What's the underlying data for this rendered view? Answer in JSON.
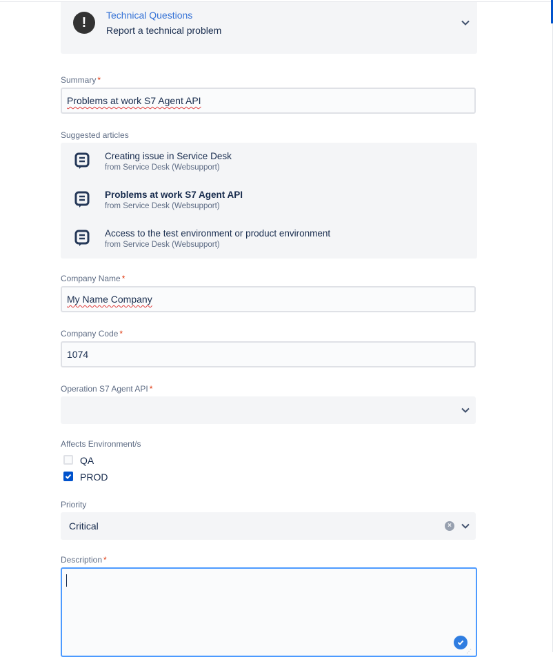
{
  "request_type": {
    "title": "Technical Questions",
    "description": "Report a technical problem",
    "icon": "exclamation-icon"
  },
  "summary": {
    "label": "Summary",
    "required_mark": "*",
    "value": "Problems at work S7 Agent API"
  },
  "suggested": {
    "label": "Suggested articles",
    "items": [
      {
        "title": "Creating issue in Service Desk",
        "source": "from Service Desk (Websupport)",
        "bold": false
      },
      {
        "title": "Problems at work S7 Agent API",
        "source": "from Service Desk (Websupport)",
        "bold": true
      },
      {
        "title": "Access to the test environment or product environment",
        "source": "from Service Desk (Websupport)",
        "bold": false
      }
    ]
  },
  "company_name": {
    "label": "Company Name",
    "required_mark": "*",
    "value": "My Name Company"
  },
  "company_code": {
    "label": "Company Code",
    "required_mark": "*",
    "value": "1074"
  },
  "operation": {
    "label": "Operation S7 Agent API",
    "required_mark": "*",
    "value": ""
  },
  "environments": {
    "label": "Affects Environment/s",
    "options": [
      {
        "label": "QA",
        "checked": false
      },
      {
        "label": "PROD",
        "checked": true
      }
    ]
  },
  "priority": {
    "label": "Priority",
    "value": "Critical"
  },
  "description": {
    "label": "Description",
    "required_mark": "*",
    "value": ""
  },
  "colors": {
    "accent": "#0052cc",
    "link": "#3572d6",
    "required": "#de350b",
    "focus_border": "#4c9aff"
  }
}
